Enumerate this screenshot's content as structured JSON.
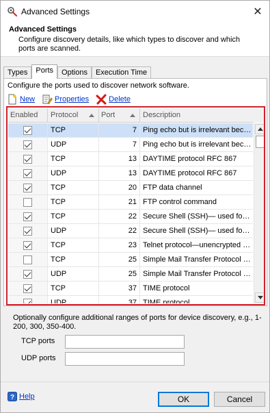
{
  "window": {
    "title": "Advanced Settings",
    "close_glyph": "✕"
  },
  "header": {
    "title": "Advanced Settings",
    "description": "Configure discovery details, like which types to discover and which ports are scanned."
  },
  "tabs": [
    {
      "label": "Types",
      "active": false
    },
    {
      "label": "Ports",
      "active": true
    },
    {
      "label": "Options",
      "active": false
    },
    {
      "label": "Execution Time",
      "active": false
    }
  ],
  "ports_panel": {
    "description": "Configure the ports used to discover network software.",
    "toolbar": {
      "new_label": "New",
      "properties_label": "Properties",
      "delete_label": "Delete"
    },
    "columns": {
      "enabled": "Enabled",
      "protocol": "Protocol",
      "port": "Port",
      "description": "Description"
    },
    "rows": [
      {
        "enabled": true,
        "protocol": "TCP",
        "port": "7",
        "description": "Ping echo but is irrelevant because ICMP",
        "selected": true
      },
      {
        "enabled": true,
        "protocol": "UDP",
        "port": "7",
        "description": "Ping echo but is irrelevant because ICMP",
        "selected": false
      },
      {
        "enabled": true,
        "protocol": "TCP",
        "port": "13",
        "description": "DAYTIME protocol RFC 867",
        "selected": false
      },
      {
        "enabled": true,
        "protocol": "UDP",
        "port": "13",
        "description": "DAYTIME protocol RFC 867",
        "selected": false
      },
      {
        "enabled": true,
        "protocol": "TCP",
        "port": "20",
        "description": "FTP data channel",
        "selected": false
      },
      {
        "enabled": false,
        "protocol": "TCP",
        "port": "21",
        "description": "FTP control command",
        "selected": false
      },
      {
        "enabled": true,
        "protocol": "TCP",
        "port": "22",
        "description": "Secure Shell (SSH)— used for secure logins",
        "selected": false
      },
      {
        "enabled": true,
        "protocol": "UDP",
        "port": "22",
        "description": "Secure Shell (SSH)— used for secure logins",
        "selected": false
      },
      {
        "enabled": true,
        "protocol": "TCP",
        "port": "23",
        "description": "Telnet protocol—unencrypted text",
        "selected": false
      },
      {
        "enabled": false,
        "protocol": "TCP",
        "port": "25",
        "description": "Simple Mail Transfer Protocol (SMTP)",
        "selected": false
      },
      {
        "enabled": true,
        "protocol": "UDP",
        "port": "25",
        "description": "Simple Mail Transfer Protocol (SMTP)",
        "selected": false
      },
      {
        "enabled": true,
        "protocol": "TCP",
        "port": "37",
        "description": "TIME protocol",
        "selected": false
      },
      {
        "enabled": true,
        "protocol": "UDP",
        "port": "37",
        "description": "TIME protocol",
        "selected": false
      }
    ]
  },
  "ranges": {
    "description": "Optionally configure additional ranges of ports for device discovery, e.g., 1-200, 300, 350-400.",
    "tcp_label": "TCP ports",
    "tcp_value": "",
    "udp_label": "UDP ports",
    "udp_value": ""
  },
  "footer": {
    "help_label": "Help",
    "ok_label": "OK",
    "cancel_label": "Cancel"
  },
  "colors": {
    "selection": "#cde0f7",
    "highlight_border": "#d0202a",
    "link": "#0033cc",
    "default_button_border": "#0078d7"
  },
  "icons": {
    "app": "settings-wrench-icon",
    "new": "new-document-icon",
    "properties": "properties-icon",
    "delete": "delete-x-icon",
    "help": "help-question-icon"
  }
}
